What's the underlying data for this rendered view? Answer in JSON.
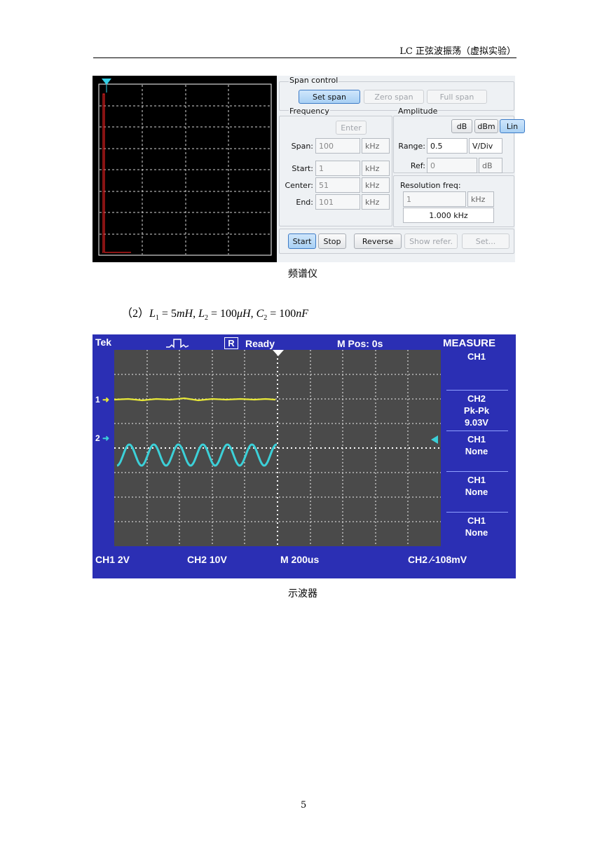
{
  "header": {
    "title": "LC 正弦波振荡（虚拟实验）"
  },
  "spectrum_analyzer": {
    "span_control": {
      "label": "Span control",
      "buttons": [
        "Set span",
        "Zero span",
        "Full span"
      ]
    },
    "frequency": {
      "label": "Frequency",
      "enter": "Enter",
      "span": {
        "label": "Span:",
        "value": "100",
        "unit": "kHz"
      },
      "start": {
        "label": "Start:",
        "value": "1",
        "unit": "kHz"
      },
      "center": {
        "label": "Center:",
        "value": "51",
        "unit": "kHz"
      },
      "end": {
        "label": "End:",
        "value": "101",
        "unit": "kHz"
      }
    },
    "amplitude": {
      "label": "Amplitude",
      "modes": [
        "dB",
        "dBm",
        "Lin"
      ],
      "range": {
        "label": "Range:",
        "value": "0.5",
        "unit": "V/Div"
      },
      "ref": {
        "label": "Ref:",
        "value": "0",
        "unit": "dB"
      }
    },
    "resolution": {
      "label": "Resolution freq:",
      "value": "1",
      "unit": "kHz",
      "readout": "1.000 kHz"
    },
    "bottom_buttons": [
      "Start",
      "Stop",
      "Reverse",
      "Show refer.",
      "Set..."
    ]
  },
  "caption_1": "频谱仪",
  "formula": {
    "prefix": "（2）",
    "parts": [
      "L",
      "1",
      " = 5",
      "mH",
      ", ",
      "L",
      "2",
      " = 100",
      "μH",
      ", ",
      "C",
      "2",
      " = 100",
      "nF"
    ]
  },
  "oscilloscope": {
    "brand": "Tek",
    "run_state_icon": "R",
    "status": "Ready",
    "mpos": "M Pos: 0s",
    "measure": "MEASURE",
    "measure_items": [
      {
        "line1": "CH1",
        "line2": "",
        "line3": ""
      },
      {
        "line1": "CH2",
        "line2": "Pk-Pk",
        "line3": "9.03V"
      },
      {
        "line1": "CH1",
        "line2": "None",
        "line3": ""
      },
      {
        "line1": "CH1",
        "line2": "None",
        "line3": ""
      },
      {
        "line1": "CH1",
        "line2": "None",
        "line3": ""
      }
    ],
    "ch1_marker": "1",
    "ch2_marker": "2",
    "ch1_scale": "CH1 2V",
    "ch2_scale": "CH2 10V",
    "timebase": "M 200us",
    "trigger": "CH2 ∕-108mV",
    "colors": {
      "ch1": "#e8e838",
      "ch2": "#3cd0d8",
      "bezel": "#2b2fb4"
    }
  },
  "caption_2": "示波器",
  "page_number": "5"
}
